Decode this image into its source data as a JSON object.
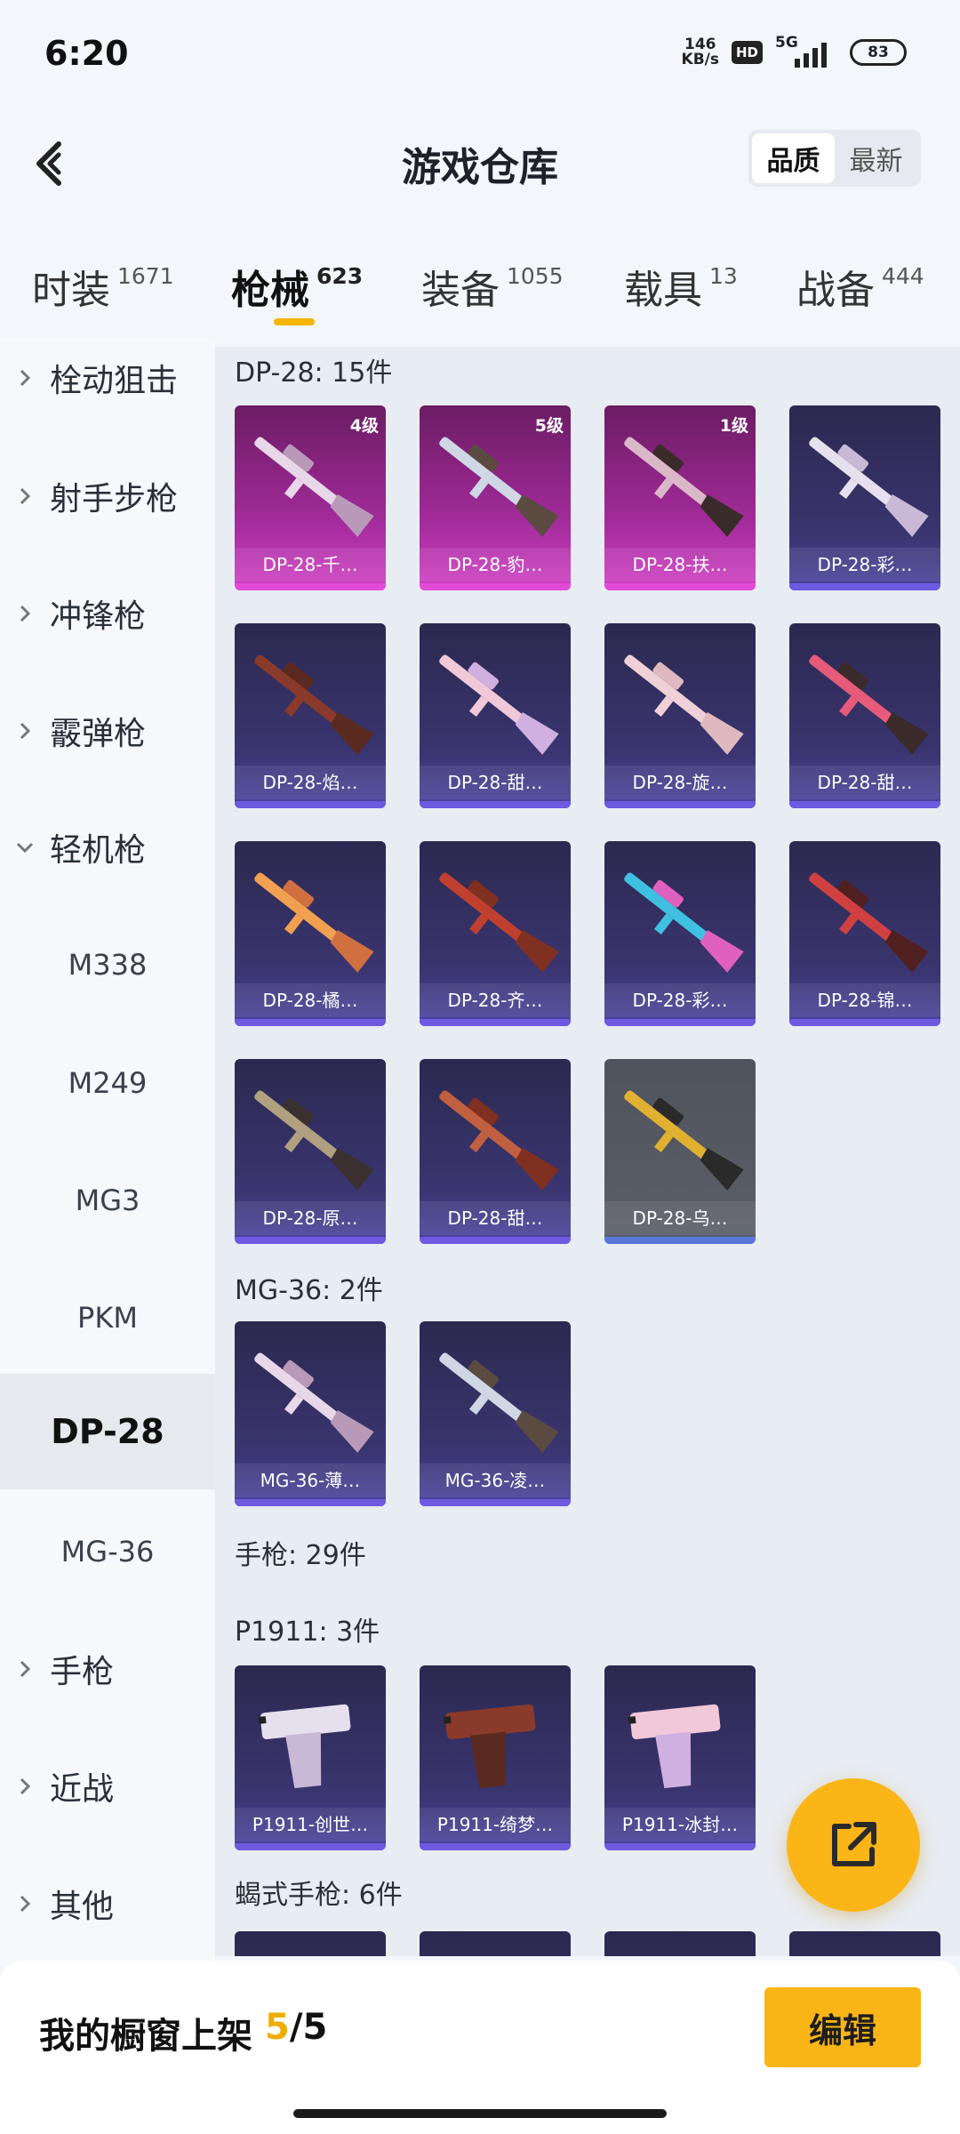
{
  "status": {
    "time": "6:20",
    "net_speed_value": "146",
    "net_speed_unit": "KB/s",
    "hd": "HD",
    "net_type": "5G",
    "battery": "83"
  },
  "header": {
    "title": "游戏仓库",
    "sort_quality": "品质",
    "sort_latest": "最新"
  },
  "tabs": [
    {
      "label": "时装",
      "count": "1671"
    },
    {
      "label": "枪械",
      "count": "623"
    },
    {
      "label": "装备",
      "count": "1055"
    },
    {
      "label": "载具",
      "count": "13"
    },
    {
      "label": "战备",
      "count": "444"
    }
  ],
  "sidebar": {
    "categories": [
      "栓动狙击",
      "射手步枪",
      "冲锋枪",
      "霰弹枪",
      "轻机枪",
      "手枪",
      "近战",
      "其他"
    ],
    "lmg_subitems": [
      "M338",
      "M249",
      "MG3",
      "PKM",
      "DP-28",
      "MG-36"
    ]
  },
  "sections": {
    "dp28_header": "DP-28: 15件",
    "mg36_header": "MG-36: 2件",
    "pistol_header": "手枪: 29件",
    "p1911_header": "P1911: 3件",
    "scorpion_header": "蝎式手枪: 6件"
  },
  "items": {
    "dp28": [
      {
        "name": "DP-28-千…",
        "level": "4级",
        "rarity": "legendary"
      },
      {
        "name": "DP-28-豹…",
        "level": "5级",
        "rarity": "legendary"
      },
      {
        "name": "DP-28-扶…",
        "level": "1级",
        "rarity": "legendary"
      },
      {
        "name": "DP-28-彩…",
        "level": "",
        "rarity": "epic"
      },
      {
        "name": "DP-28-焰…",
        "level": "",
        "rarity": "epic"
      },
      {
        "name": "DP-28-甜…",
        "level": "",
        "rarity": "epic"
      },
      {
        "name": "DP-28-旋…",
        "level": "",
        "rarity": "epic"
      },
      {
        "name": "DP-28-甜…",
        "level": "",
        "rarity": "epic"
      },
      {
        "name": "DP-28-橘…",
        "level": "",
        "rarity": "epic"
      },
      {
        "name": "DP-28-齐…",
        "level": "",
        "rarity": "epic"
      },
      {
        "name": "DP-28-彩…",
        "level": "",
        "rarity": "epic"
      },
      {
        "name": "DP-28-锦…",
        "level": "",
        "rarity": "epic"
      },
      {
        "name": "DP-28-原…",
        "level": "",
        "rarity": "epic"
      },
      {
        "name": "DP-28-甜…",
        "level": "",
        "rarity": "epic"
      },
      {
        "name": "DP-28-乌…",
        "level": "",
        "rarity": "rare"
      }
    ],
    "mg36": [
      {
        "name": "MG-36-薄…"
      },
      {
        "name": "MG-36-凌…"
      }
    ],
    "p1911": [
      {
        "name": "P1911-创世…"
      },
      {
        "name": "P1911-绮梦…"
      },
      {
        "name": "P1911-冰封…"
      }
    ]
  },
  "bottom": {
    "showcase_label": "我的橱窗上架",
    "showcase_current": "5",
    "showcase_total": "/5",
    "edit_button": "编辑"
  },
  "colors": {
    "accent": "#fbb516",
    "epic": "#4b44a0",
    "legendary": "#d141c5",
    "rare": "#5b5f69"
  }
}
